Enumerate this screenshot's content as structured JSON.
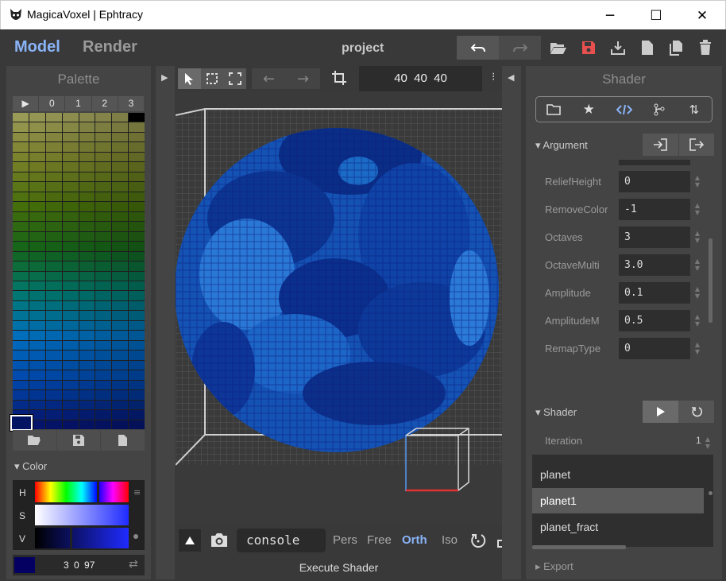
{
  "window": {
    "title": "MagicaVoxel | Ephtracy",
    "minimize": "─",
    "maximize": "☐",
    "close": "✕"
  },
  "topbar": {
    "model_tab": "Model",
    "render_tab": "Render",
    "project_name": "project"
  },
  "palette": {
    "title": "Palette",
    "tabs": [
      "▶",
      "0",
      "1",
      "2",
      "3"
    ],
    "selected_color": "#021462"
  },
  "color": {
    "section_label": "Color",
    "h_label": "H",
    "s_label": "S",
    "v_label": "V",
    "rgb_value": "3 0 97"
  },
  "viewport": {
    "dimensions": "40  40  40",
    "console_text": "console",
    "view_modes": [
      "Pers",
      "Free",
      "Orth",
      "Iso"
    ],
    "active_view_mode": "Orth",
    "status": "Execute Shader"
  },
  "shader_panel": {
    "title": "Shader",
    "argument_section": "Argument",
    "arguments": [
      {
        "name": "ReliefHeight",
        "value": "0"
      },
      {
        "name": "RemoveColor",
        "value": "-1"
      },
      {
        "name": "Octaves",
        "value": "3"
      },
      {
        "name": "OctaveMulti",
        "value": "3.0"
      },
      {
        "name": "Amplitude",
        "value": "0.1"
      },
      {
        "name": "AmplitudeM",
        "value": "0.5"
      },
      {
        "name": "RemapType",
        "value": "0"
      }
    ],
    "shader_section": "Shader",
    "iteration_label": "Iteration",
    "iteration_value": "1",
    "shaders": [
      "planet",
      "planet1",
      "planet_fract"
    ],
    "selected_shader": "planet1",
    "export_section": "Export"
  },
  "colors": {
    "accent": "#8ab4f8",
    "save_red": "#e8504f",
    "selection_bg": "#5a5a5a"
  }
}
